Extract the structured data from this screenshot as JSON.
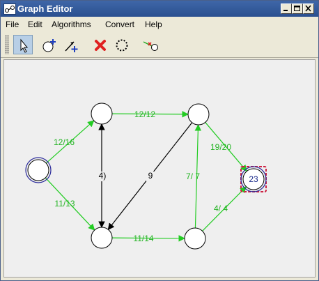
{
  "window": {
    "title": "Graph Editor"
  },
  "titlebar_buttons": [
    "minimize",
    "maximize",
    "close"
  ],
  "menu": [
    {
      "label": "File"
    },
    {
      "label": "Edit"
    },
    {
      "label": "Algorithms"
    },
    {
      "label": "Convert"
    },
    {
      "label": "Help"
    }
  ],
  "toolbar": [
    {
      "name": "select-tool",
      "icon": "arrow-cursor-icon",
      "active": true
    },
    {
      "name": "add-node-tool",
      "icon": "add-node-icon",
      "active": false
    },
    {
      "name": "add-edge-tool",
      "icon": "add-edge-icon",
      "active": false
    },
    {
      "name": "delete-tool",
      "icon": "red-x-icon",
      "active": false
    },
    {
      "name": "circle-layout-tool",
      "icon": "dotted-circle-icon",
      "active": false
    },
    {
      "name": "edge-remove-tool",
      "icon": "edge-remove-icon",
      "active": false
    }
  ],
  "graph": {
    "nodes": [
      {
        "id": "s",
        "label": "",
        "kind": "source"
      },
      {
        "id": "a",
        "label": "",
        "kind": "normal"
      },
      {
        "id": "b",
        "label": "",
        "kind": "normal"
      },
      {
        "id": "c",
        "label": "",
        "kind": "normal"
      },
      {
        "id": "d",
        "label": "",
        "kind": "normal"
      },
      {
        "id": "t",
        "label": "23",
        "kind": "sink"
      }
    ],
    "edges": [
      {
        "from": "s",
        "to": "a",
        "label": "12/16",
        "color": "#22cc22"
      },
      {
        "from": "s",
        "to": "b",
        "label": "11/13",
        "color": "#22cc22"
      },
      {
        "from": "a",
        "to": "c",
        "label": "12/12",
        "color": "#22cc22"
      },
      {
        "from": "b",
        "to": "d",
        "label": "11/14",
        "color": "#22cc22"
      },
      {
        "from": "c",
        "to": "b",
        "label": "9",
        "color": "#000000"
      },
      {
        "from": "a",
        "to": "b",
        "label": "4)",
        "color": "#000000",
        "bidirectional": true
      },
      {
        "from": "d",
        "to": "c",
        "label": "7/ 7",
        "color": "#22cc22"
      },
      {
        "from": "c",
        "to": "t",
        "label": "19/20",
        "color": "#22cc22"
      },
      {
        "from": "d",
        "to": "t",
        "label": "4/ 4",
        "color": "#22cc22"
      }
    ]
  },
  "colors": {
    "flow_edge": "#22cc22",
    "plain_edge": "#000000",
    "source_ring": "#2a2a9a",
    "sink_highlight": "#cc2244",
    "sink_label": "#1a2a8a"
  }
}
